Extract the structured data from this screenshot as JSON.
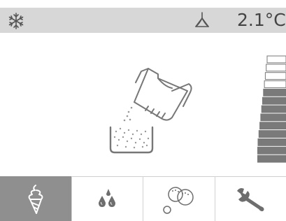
{
  "status_bar": {
    "mode_icon": "snowflake-icon",
    "stirrer_icon": "stirrer-icon",
    "temperature": "2.1°C"
  },
  "main": {
    "illustration": "pouring-mix-into-tank",
    "level_meter": {
      "total_segments": 13,
      "filled_segments": 9
    }
  },
  "nav": {
    "active_index": 0,
    "tabs": [
      {
        "icon": "ice-cream-cone-icon"
      },
      {
        "icon": "drops-icon"
      },
      {
        "icon": "bubbles-icon"
      },
      {
        "icon": "wrench-icon"
      }
    ]
  },
  "colors": {
    "status_bg": "#d7d7d7",
    "active_tab": "#8f8f8f",
    "icon_gray": "#6e6e6e",
    "meter_fill": "#7a7a7a"
  }
}
